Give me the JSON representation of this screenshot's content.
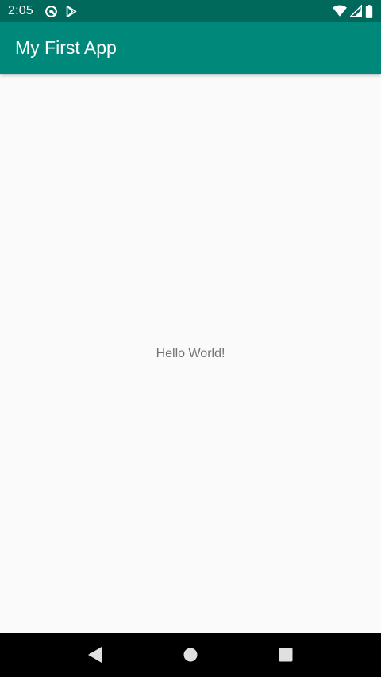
{
  "status_bar": {
    "time": "2:05",
    "left_icons": [
      "at-sign-notification-icon",
      "play-store-icon"
    ],
    "right_icons": [
      "wifi-icon",
      "cell-signal-icon",
      "battery-icon"
    ],
    "background": "#00695c"
  },
  "app_bar": {
    "title": "My First App",
    "background": "#00897b"
  },
  "content": {
    "text": "Hello World!"
  },
  "nav_bar": {
    "buttons": [
      "back-icon",
      "home-icon",
      "recents-icon"
    ]
  }
}
